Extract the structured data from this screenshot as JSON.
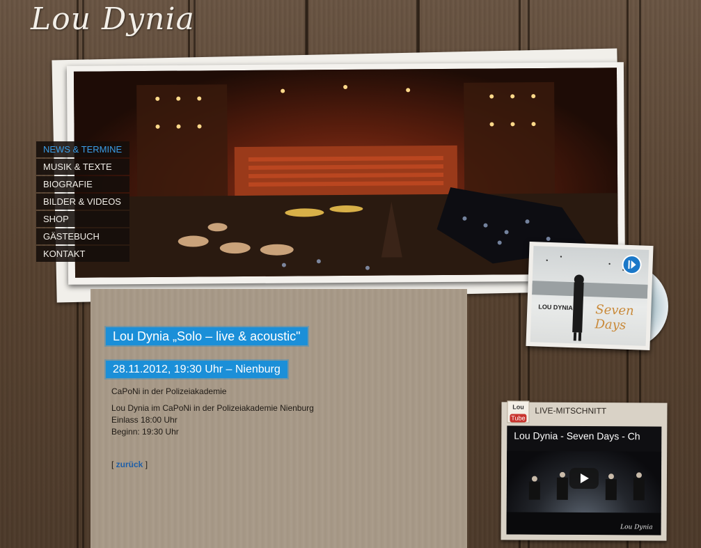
{
  "site": {
    "logo": "Lou Dynia"
  },
  "nav": [
    {
      "label": "NEWS & TERMINE",
      "active": true
    },
    {
      "label": "MUSIK & TEXTE",
      "active": false
    },
    {
      "label": "BIOGRAFIE",
      "active": false
    },
    {
      "label": "BILDER & VIDEOS",
      "active": false
    },
    {
      "label": "SHOP",
      "active": false
    },
    {
      "label": "GÄSTEBUCH",
      "active": false
    },
    {
      "label": "KONTAKT",
      "active": false
    }
  ],
  "event": {
    "title": "Lou Dynia „Solo – live & acoustic\"",
    "date": "28.11.2012, 19:30 Uhr – Nienburg",
    "venue": "CaPoNi in der Polizeiakademie",
    "desc1": "Lou Dynia im CaPoNi in der Polizeiakademie Nienburg",
    "desc2": "Einlass 18:00 Uhr",
    "desc3": "Beginn: 19:30 Uhr",
    "back_open": "[ ",
    "back_label": "zurück",
    "back_close": " ]"
  },
  "album": {
    "artist": "LOU DYNIA",
    "title": "Seven Days",
    "icon": "play-icon"
  },
  "live": {
    "logo_top": "Lou",
    "logo_bottom": "Tube",
    "label": "LIVE-MITSCHNITT",
    "video_title": "Lou Dynia - Seven Days - Ch",
    "video_sign": "Lou Dynia"
  },
  "colors": {
    "accent": "#1b8fd8",
    "nav_active": "#3b9ee8",
    "nav_bg": "#14100c"
  }
}
